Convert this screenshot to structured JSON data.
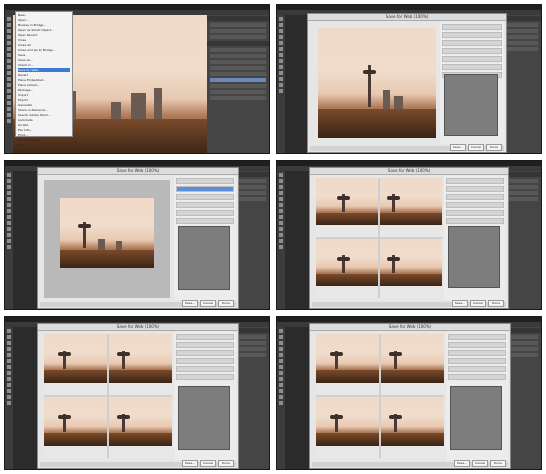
{
  "panels": [
    {
      "id": "p1",
      "label": "panel-1-file-menu"
    },
    {
      "id": "p2",
      "label": "panel-2-save-for-web-original"
    },
    {
      "id": "p3",
      "label": "panel-3-save-for-web-optimized"
    },
    {
      "id": "p4",
      "label": "panel-4-four-up"
    },
    {
      "id": "p5",
      "label": "panel-5-four-up"
    },
    {
      "id": "p6",
      "label": "panel-6-four-up"
    }
  ],
  "dialog": {
    "title": "Save for Web (100%)",
    "save": "Save...",
    "cancel": "Cancel",
    "done": "Done"
  },
  "file_menu": {
    "items": [
      "New...",
      "Open...",
      "Browse in Bridge...",
      "Open as Smart Object...",
      "Open Recent",
      "Close",
      "Close All",
      "Close and Go to Bridge...",
      "Save",
      "Save As...",
      "Check In...",
      "Save for Web...",
      "Revert",
      "Place Embedded...",
      "Place Linked...",
      "Package...",
      "Import",
      "Export",
      "Generate",
      "Share on Behance...",
      "Search Adobe Stock...",
      "Automate",
      "Scripts",
      "File Info...",
      "Print...",
      "Print One Copy",
      "Exit"
    ],
    "highlighted_index": 11
  },
  "colors": {
    "ps_dark": "#2b2b2b",
    "menu_hl": "#3d7ad6",
    "swatch": "#7d7d7d"
  }
}
